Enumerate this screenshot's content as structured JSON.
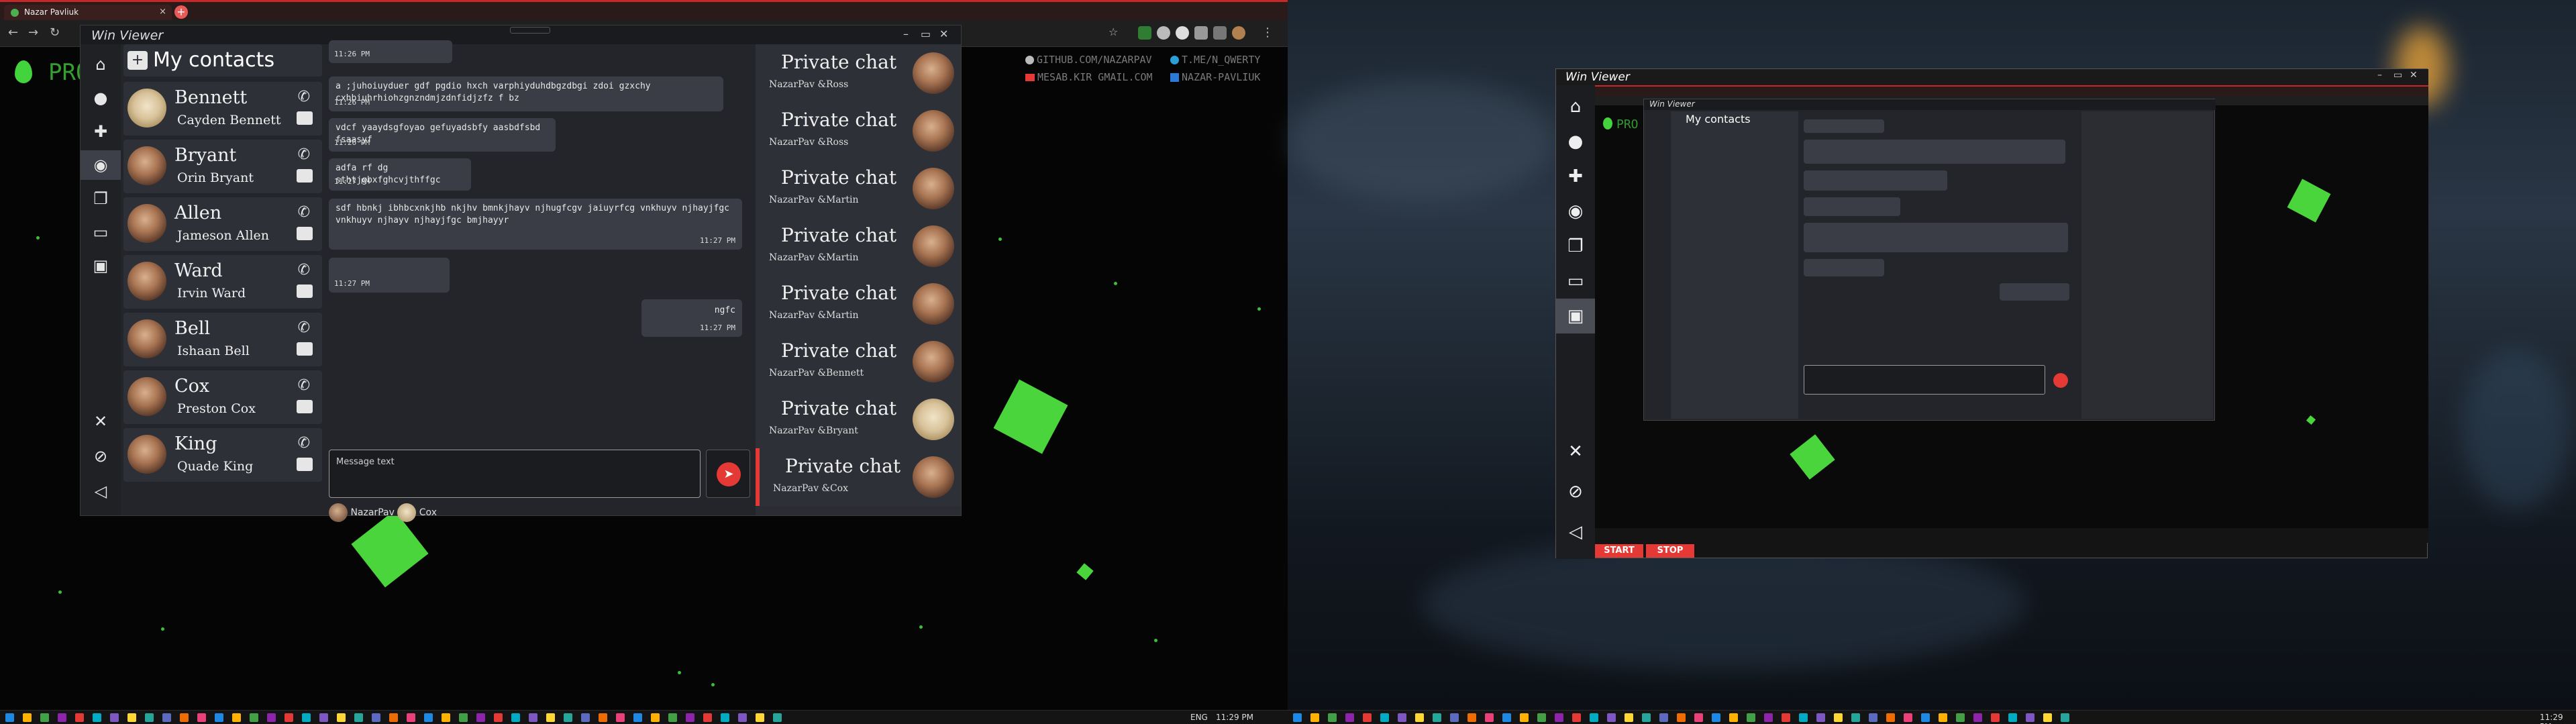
{
  "browser": {
    "tab_title": "Nazar Pavliuk",
    "tab_close": "×",
    "new_tab": "+"
  },
  "page": {
    "logo_text": "PRO",
    "links": {
      "github": "GITHUB.COM/NAZARPAV",
      "telegram": "T.ME/N_QWERTY",
      "email": "MESAB.KIR GMAIL.COM",
      "linkedin": "NAZAR-PAVLIUK"
    }
  },
  "app": {
    "window_title": "Win Viewer",
    "window_controls": [
      "–",
      "▭",
      "✕"
    ],
    "contacts_header": "My contacts",
    "contacts": [
      {
        "first": "Bennett",
        "full": "Cayden Bennett",
        "avatar": "cat"
      },
      {
        "first": "Bryant",
        "full": "Orin Bryant",
        "avatar": "person"
      },
      {
        "first": "Allen",
        "full": "Jameson Allen",
        "avatar": "person"
      },
      {
        "first": "Ward",
        "full": "Irvin Ward",
        "avatar": "person"
      },
      {
        "first": "Bell",
        "full": "Ishaan Bell",
        "avatar": "person"
      },
      {
        "first": "Cox",
        "full": "Preston Cox",
        "avatar": "person"
      },
      {
        "first": "King",
        "full": "Quade King",
        "avatar": "person"
      }
    ],
    "messages": [
      {
        "text": "",
        "time": "11:26 PM",
        "side": "left"
      },
      {
        "text": "a ;juhoiuyduer gdf pgdio hxch varphiyduhdbgzdbgi zdoi gzxchy cxhbiuhrhiohzgnzndmjzdnfidjzfz f bz",
        "time": "11:26 PM",
        "side": "left"
      },
      {
        "text": "vdcf yaaydsgfoyao gefuyadsbfy aasbdfsbd fsaasyf",
        "time": "11:26 PM",
        "side": "left"
      },
      {
        "text": "adfa rf dg sthtjgbxfghcvjthffgc",
        "time": "11:27 PM",
        "side": "left"
      },
      {
        "text": "sdf hbnkj ibhbcxnkjhb nkjhv bmnkjhayv njhugfcgv jaiuyrfcg vnkhuyv njhayjfgc vnkhuyv njhayv njhayjfgc bmjhayyr",
        "time": "11:27 PM",
        "side": "left"
      },
      {
        "text": "",
        "time": "11:27 PM",
        "side": "left"
      },
      {
        "text": "ngfc",
        "time": "11:27 PM",
        "side": "right"
      }
    ],
    "input_placeholder": "Message text",
    "participants": [
      {
        "name": "NazarPav"
      },
      {
        "name": "Cox"
      }
    ],
    "private_title": "Private chat",
    "private_chats": [
      {
        "with": "NazarPav &Ross",
        "avatar": "person"
      },
      {
        "with": "NazarPav &Ross",
        "avatar": "person"
      },
      {
        "with": "NazarPav &Martin",
        "avatar": "person"
      },
      {
        "with": "NazarPav &Martin",
        "avatar": "person"
      },
      {
        "with": "NazarPav &Martin",
        "avatar": "person"
      },
      {
        "with": "NazarPav &Bennett",
        "avatar": "person"
      },
      {
        "with": "NazarPav &Bryant",
        "avatar": "cat"
      },
      {
        "with": "NazarPav &Cox",
        "avatar": "person"
      }
    ]
  },
  "viewer": {
    "title": "Win Viewer",
    "start_label": "START",
    "stop_label": "STOP"
  },
  "taskbar": {
    "lang": "ENG",
    "time_left": "11:29 PM",
    "time_right": "11:29 PM"
  },
  "colors": {
    "accent_red": "#e53935",
    "green": "#43d33d",
    "panel": "#2e3037"
  }
}
